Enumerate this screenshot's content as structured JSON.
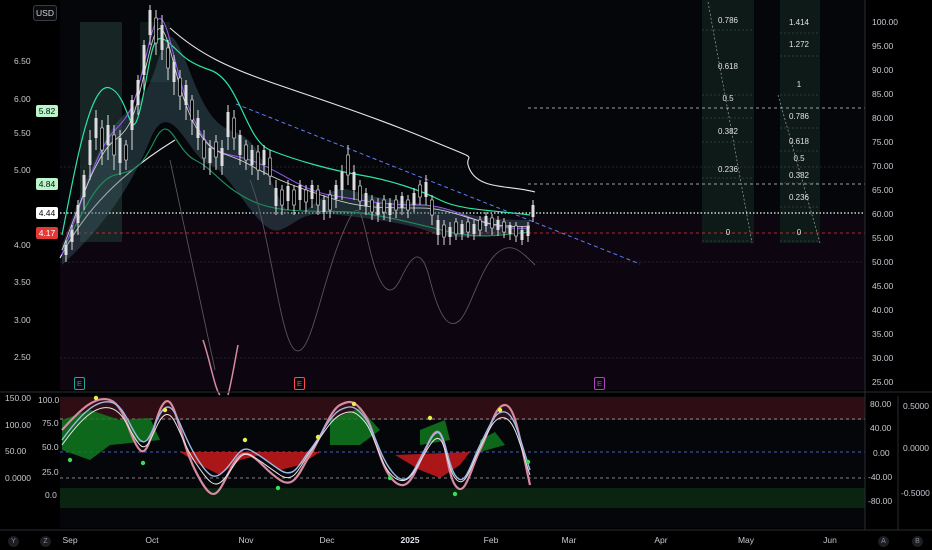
{
  "toolbar": {
    "currency": "USD"
  },
  "price_axis_left": [
    "6.50",
    "6.00",
    "5.50",
    "5.00",
    "4.00",
    "3.50",
    "3.00",
    "2.50"
  ],
  "price_badges": [
    {
      "value": "5.82",
      "bg": "#b9f6ca",
      "fg": "#0a0a0a"
    },
    {
      "value": "4.84",
      "bg": "#b9f6ca",
      "fg": "#0a0a0a"
    },
    {
      "value": "4.44",
      "bg": "#ffffff",
      "fg": "#0a0a0a"
    },
    {
      "value": "4.17",
      "bg": "#e53935",
      "fg": "#ffffff"
    }
  ],
  "price_axis_right": [
    "100.00",
    "95.00",
    "90.00",
    "85.00",
    "80.00",
    "75.00",
    "70.00",
    "65.00",
    "60.00",
    "55.00",
    "50.00",
    "45.00",
    "40.00",
    "35.00",
    "30.00",
    "25.00"
  ],
  "osc_axis_left": [
    "150.00",
    "100.00",
    "50.00",
    "0.0000"
  ],
  "osc_scale_inner": [
    "100.0",
    "75.0",
    "50.0",
    "25.0",
    "0.0"
  ],
  "osc_axis_right_inner": [
    "80.00",
    "40.00",
    "0.00",
    "-40.00",
    "-80.00"
  ],
  "osc_axis_right_outer": [
    "0.5000",
    "0.0000",
    "-0.5000"
  ],
  "time_axis": [
    "Sep",
    "Oct",
    "Nov",
    "Dec",
    "2025",
    "Feb",
    "Mar",
    "Apr",
    "May",
    "Jun"
  ],
  "fib_left": [
    "0.786",
    "0.618",
    "0.5",
    "0.382",
    "0.236",
    "0"
  ],
  "fib_right": [
    "1.414",
    "1.272",
    "1",
    "0.786",
    "0.618",
    "0.5",
    "0.382",
    "0.236",
    "0"
  ],
  "earnings_flags": [
    "E",
    "E",
    "E"
  ],
  "bottom_tools": [
    "Y",
    "Z",
    "A",
    "B"
  ],
  "colors": {
    "bg": "#000000",
    "bull": "#e6e6e6",
    "bear": "#ffffff",
    "band": "#2ce6a0",
    "trend": "#5c7cfa",
    "red_line": "#e53935",
    "magenta": "#c2185b"
  }
}
